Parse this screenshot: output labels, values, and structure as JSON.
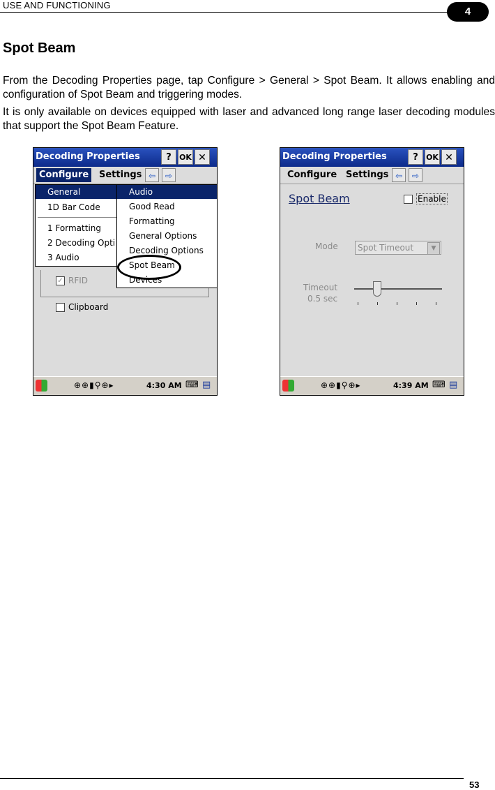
{
  "header": {
    "section": "USE AND FUNCTIONING",
    "chapter": "4"
  },
  "title": "Spot Beam",
  "paragraphs": [
    "From the Decoding Properties page, tap Configure > General > Spot Beam. It allows enabling and configuration of Spot Beam and triggering modes.",
    "It is only available on devices equipped with laser and advanced long range laser decoding modules that support the Spot Beam Feature."
  ],
  "screen1": {
    "title": "Decoding Properties",
    "help": "?",
    "ok": "OK",
    "close": "✕",
    "menu": [
      "Configure",
      "Settings"
    ],
    "configure_menu": [
      "General",
      "1D Bar Code",
      "1 Formatting",
      "2 Decoding Opti",
      "3 Audio"
    ],
    "general_submenu": [
      "Audio",
      "Good Read",
      "Formatting",
      "General Options",
      "Decoding Options",
      "Spot Beam",
      "Devices"
    ],
    "behind": [
      "RFID",
      "Clipboard"
    ],
    "time": "4:30 AM"
  },
  "screen2": {
    "title": "Decoding Properties",
    "help": "?",
    "ok": "OK",
    "close": "✕",
    "menu": [
      "Configure",
      "Settings"
    ],
    "heading": "Spot Beam",
    "enable_label": "Enable",
    "mode_label": "Mode",
    "mode_value": "Spot Timeout",
    "timeout_label": "Timeout",
    "timeout_value": "0.5 sec",
    "time": "4:39 AM"
  },
  "footer": {
    "page": "53"
  }
}
